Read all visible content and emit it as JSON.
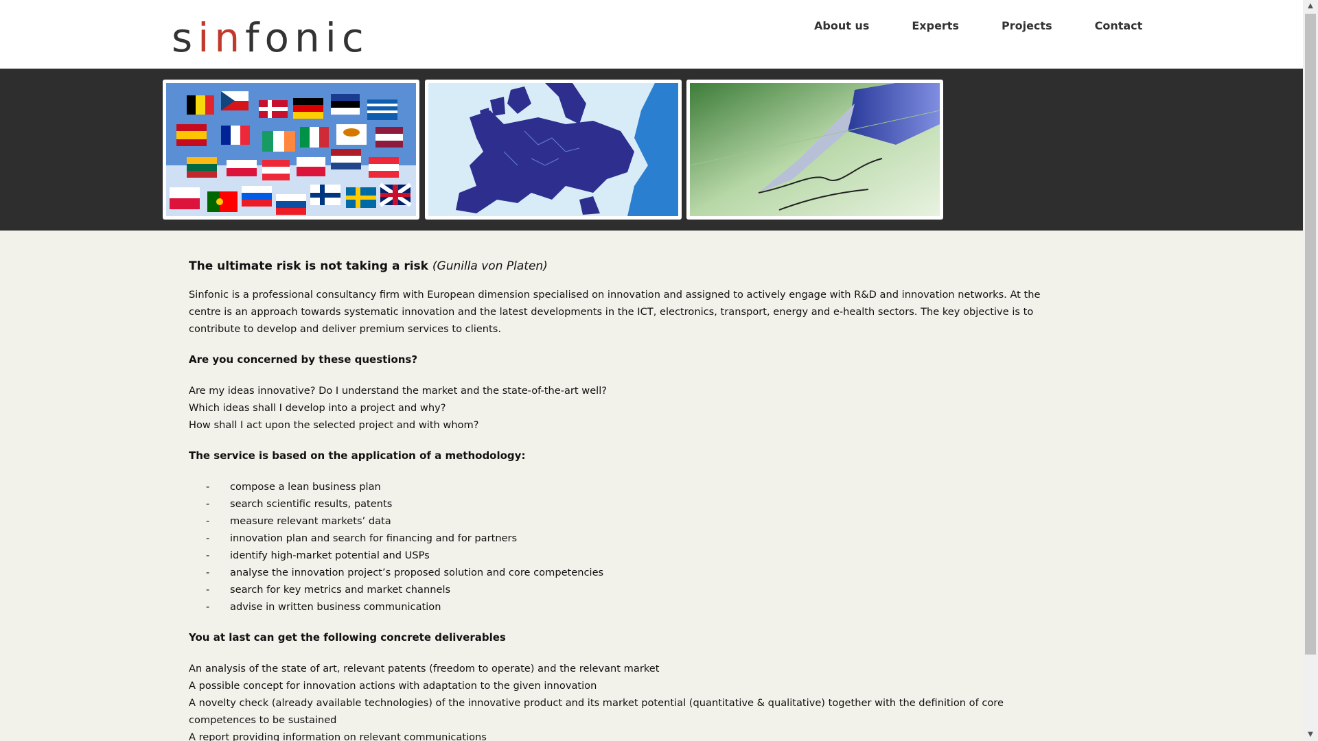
{
  "header": {
    "logo_prefix": "s",
    "logo_red": "in",
    "logo_suffix": "fonic",
    "nav": [
      "About us",
      "Experts",
      "Projects",
      "Contact"
    ]
  },
  "banner": {
    "images": [
      "european-flags-image",
      "europe-map-image",
      "fountain-pen-signature-image"
    ]
  },
  "content": {
    "quote": "The ultimate risk is not taking a risk",
    "quote_author": "(Gunilla von Platen)",
    "intro": "Sinfonic is a professional consultancy firm with European dimension specialised on innovation and assigned to actively engage with R&D and innovation networks. At the centre is an approach towards systematic innovation and the latest developments in the ICT, electronics, transport, energy and e-health sectors. The key objective is to contribute to develop and deliver premium services to clients.",
    "questions_heading": "Are you concerned by these questions?",
    "questions": [
      "Are my ideas innovative? Do I understand the market and the state-of-the-art well?",
      "Which ideas shall I develop into a project and why?",
      "How shall I act upon the selected project and with whom?"
    ],
    "method_heading": "The service is based on the application of a methodology:",
    "methods": [
      "compose a lean business plan",
      "search scientific results, patents",
      "measure relevant markets’ data",
      "innovation plan and search for financing and for partners",
      "identify high-market potential and USPs",
      "analyse the innovation project’s proposed solution and core competencies",
      "search for key metrics and market channels",
      "advise in written business communication"
    ],
    "deliverables_heading": "You at last can get the following concrete deliverables",
    "deliverables": [
      "An analysis of the state of art, relevant patents (freedom to operate) and the relevant market",
      "A possible concept for innovation actions with adaptation to the given innovation",
      "A novelty check (already available technologies) of the innovative product and its market potential (quantitative & qualitative) together with the definition of core competences to be sustained",
      "A report providing information on relevant communications"
    ]
  },
  "colors": {
    "banner_bg": "#2e2e2e",
    "page_bg": "#f2f1ea",
    "logo_accent": "#c0392b"
  }
}
